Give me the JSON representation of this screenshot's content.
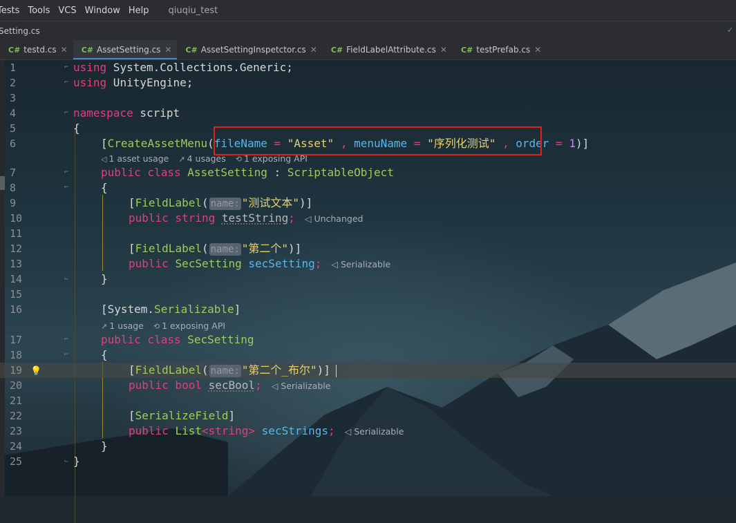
{
  "menu": {
    "items": [
      "Tests",
      "Tools",
      "VCS",
      "Window",
      "Help"
    ],
    "project": "qiuqiu_test"
  },
  "breadcrumb": {
    "file": "Setting.cs"
  },
  "tabs": [
    {
      "lang": "C#",
      "label": "testd.cs",
      "active": false
    },
    {
      "lang": "C#",
      "label": "AssetSetting.cs",
      "active": true
    },
    {
      "lang": "C#",
      "label": "AssetSettingInspetctor.cs",
      "active": false
    },
    {
      "lang": "C#",
      "label": "FieldLabelAttribute.cs",
      "active": false
    },
    {
      "lang": "C#",
      "label": "testPrefab.cs",
      "active": false
    }
  ],
  "editor": {
    "current_line": 19,
    "line_numbers": [
      "1",
      "2",
      "3",
      "4",
      "5",
      "6",
      "7",
      "8",
      "9",
      "10",
      "11",
      "12",
      "13",
      "14",
      "15",
      "16",
      "17",
      "18",
      "19",
      "20",
      "21",
      "22",
      "23",
      "24",
      "25"
    ],
    "code": {
      "l1_kw": "using",
      "l1_rest": " System.Collections.Generic;",
      "l2_kw": "using",
      "l2_rest": " UnityEngine;",
      "l4_kw": "namespace",
      "l4_rest": " script",
      "l5": "{",
      "l6_open": "[",
      "l6_attr": "CreateAssetMenu",
      "l6_paren": "(",
      "l6_p1": "fileName",
      "l6_eq1": " = ",
      "l6_s1": "\"Asset\"",
      "l6_c1": " , ",
      "l6_p2": "menuName",
      "l6_eq2": " = ",
      "l6_s2": "\"序列化测试\"",
      "l6_c2": " , ",
      "l6_p3": "order",
      "l6_eq3": " = ",
      "l6_n": "1",
      "l6_close": ")]",
      "l7_kw": "public class",
      "l7_cls": "AssetSetting",
      "l7_colon": " : ",
      "l7_base": "ScriptableObject",
      "l8": "{",
      "l9_open": "[",
      "l9_attr": "FieldLabel",
      "l9_paren": "(",
      "l9_hint": "name:",
      "l9_str": "\"测试文本\"",
      "l9_close": ")]",
      "l10_kw": "public string",
      "l10_field": "testString",
      "l10_semi": ";",
      "l10_annot": "Unchanged",
      "l12_open": "[",
      "l12_attr": "FieldLabel",
      "l12_paren": "(",
      "l12_hint": "name:",
      "l12_str": "\"第二个\"",
      "l12_close": ")]",
      "l13_kw": "public",
      "l13_type": "SecSetting",
      "l13_field": "secSetting",
      "l13_semi": ";",
      "l13_annot": "Serializable",
      "l14": "}",
      "l16_open": "[System.",
      "l16_attr": "Serializable",
      "l16_close": "]",
      "l17_kw": "public class",
      "l17_cls": "SecSetting",
      "l18": "{",
      "l19_open": "[",
      "l19_attr": "FieldLabel",
      "l19_paren": "(",
      "l19_hint": "name:",
      "l19_str": "\"第二个_布尔\"",
      "l19_close": ")]",
      "l20_kw": "public bool",
      "l20_field": "secBool",
      "l20_semi": ";",
      "l20_annot": "Serializable",
      "l22_open": "[",
      "l22_attr": "SerializeField",
      "l22_close": "]",
      "l23_kw": "public",
      "l23_type": "List",
      "l23_generic": "<string>",
      "l23_field": "secStrings",
      "l23_semi": ";",
      "l23_annot": "Serializable",
      "l24": "}",
      "l25": "}"
    },
    "lens_asset": [
      "1 asset usage",
      "4 usages",
      "1 exposing API"
    ],
    "lens_sec": [
      "1 usage",
      "1 exposing API"
    ]
  },
  "colors": {
    "keyword": "#e0407a",
    "type": "#9ecb5a",
    "string": "#e8d06a",
    "property": "#5bb6e8",
    "number": "#b68cf7",
    "highlight_box": "#e0201a"
  }
}
